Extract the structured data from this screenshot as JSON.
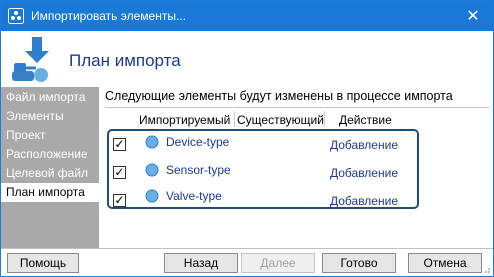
{
  "window": {
    "title": "Импортировать элементы...",
    "close_glyph": "✕",
    "accent": "#1a78d6"
  },
  "header": {
    "title": "План импорта"
  },
  "sidebar": {
    "items": [
      {
        "label": "Файл импорта"
      },
      {
        "label": "Элементы"
      },
      {
        "label": "Проект"
      },
      {
        "label": "Расположение"
      },
      {
        "label": "Целевой файл"
      },
      {
        "label": "План импорта",
        "active": true
      }
    ]
  },
  "content": {
    "heading": "Следующие элементы будут изменены в процессе импорта",
    "columns": [
      "Импортируемый",
      "Существующий",
      "Действие"
    ],
    "rows": [
      {
        "checked": true,
        "name": "Device-type",
        "existing": "",
        "action": "Добавление"
      },
      {
        "checked": true,
        "name": "Sensor-type",
        "existing": "",
        "action": "Добавление"
      },
      {
        "checked": true,
        "name": "Valve-type",
        "existing": "",
        "action": "Добавление"
      }
    ]
  },
  "footer": {
    "help_label": "Помощь",
    "back_label": "Назад",
    "next_label": "Далее",
    "finish_label": "Готово",
    "cancel_label": "Отмена"
  }
}
